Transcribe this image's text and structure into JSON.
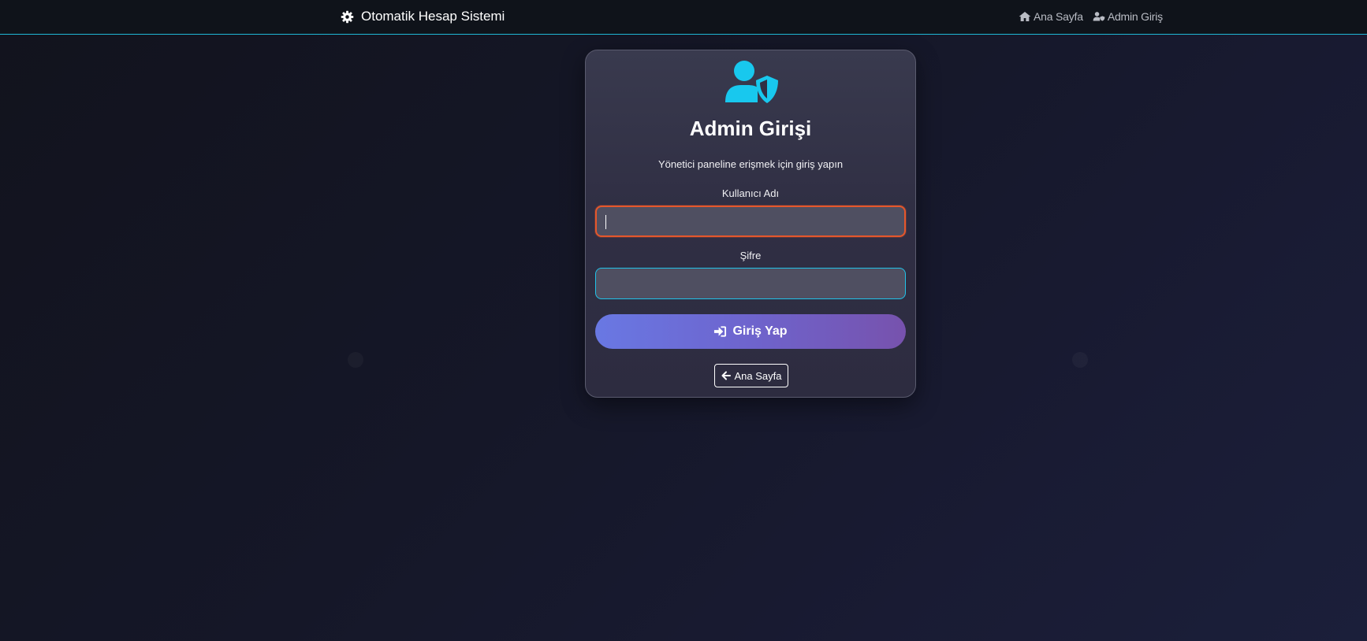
{
  "navbar": {
    "brand_icon": "gear-icon",
    "brand_title": "Otomatik Hesap Sistemi",
    "links": [
      {
        "label": "Ana Sayfa",
        "icon": "home-icon"
      },
      {
        "label": "Admin Giriş",
        "icon": "user-shield-icon"
      }
    ],
    "accent_color": "#1fb8d6"
  },
  "login_card": {
    "icon": "user-shield-icon",
    "icon_color": "#18c8ee",
    "title": "Admin Girişi",
    "subtitle": "Yönetici paneline erişmek için giriş yapın",
    "username": {
      "label": "Kullanıcı Adı",
      "value": "",
      "focused": true
    },
    "password": {
      "label": "Şifre",
      "value": ""
    },
    "submit": {
      "label": "Giriş Yap",
      "icon": "sign-in-icon"
    },
    "back": {
      "label": "Ana Sayfa",
      "icon": "arrow-left-icon"
    }
  },
  "colors": {
    "focus_border": "#e5572c",
    "input_border": "#21c3e8",
    "button_gradient_start": "#6978e3",
    "button_gradient_end": "#7752ad"
  }
}
